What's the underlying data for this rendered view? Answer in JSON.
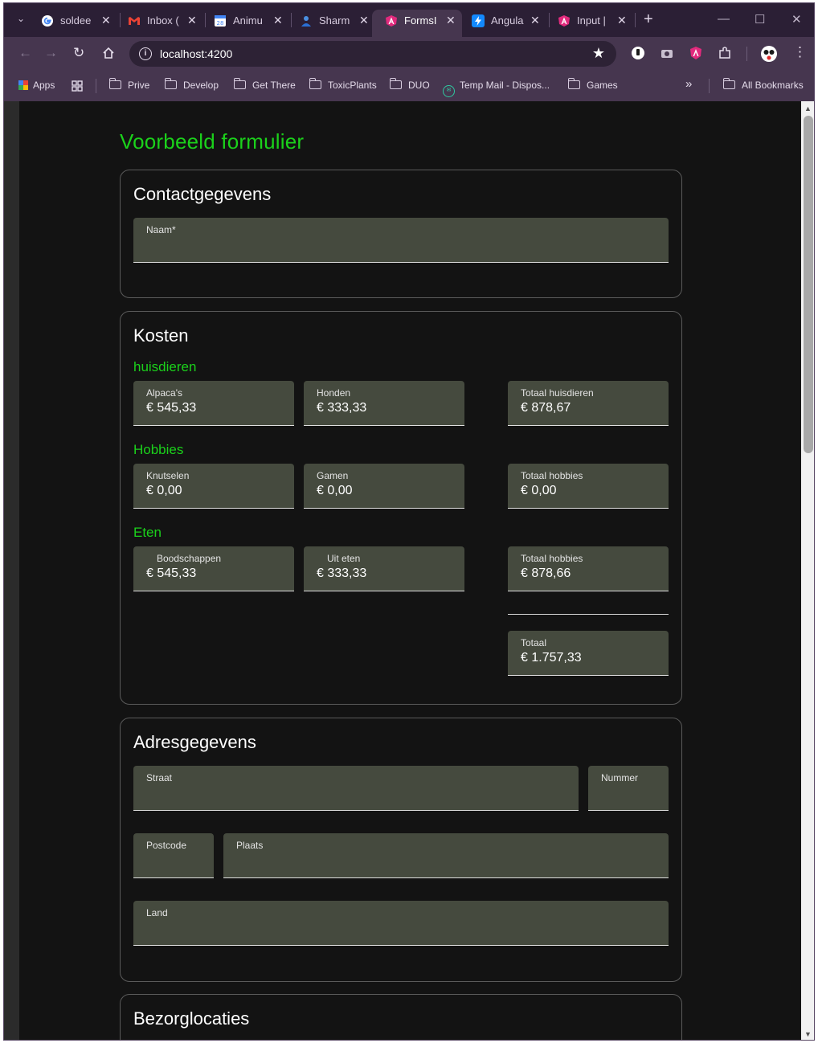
{
  "browser": {
    "tabs": [
      {
        "title": "soldee",
        "favicon": "google-icon"
      },
      {
        "title": "Inbox (",
        "favicon": "gmail-icon"
      },
      {
        "title": "Animu",
        "favicon": "calendar-icon"
      },
      {
        "title": "Sharm",
        "favicon": "person-icon"
      },
      {
        "title": "FormsI",
        "favicon": "angular-icon",
        "active": true
      },
      {
        "title": "Angula",
        "favicon": "stackblitz-icon"
      },
      {
        "title": "Input |",
        "favicon": "angular-icon"
      }
    ],
    "new_tab": "+",
    "address": "localhost:4200",
    "bookmarks": {
      "apps": "Apps",
      "items": [
        "Prive",
        "Develop",
        "Get There",
        "ToxicPlants",
        "DUO",
        "Temp Mail - Dispos...",
        "Games"
      ],
      "more": "»",
      "all": "All Bookmarks"
    }
  },
  "page": {
    "title": "Voorbeeld formulier",
    "contact": {
      "heading": "Contactgegevens",
      "name_label": "Naam*",
      "name_value": ""
    },
    "kosten": {
      "heading": "Kosten",
      "groups": [
        {
          "title": "huisdieren",
          "fields": [
            {
              "label": "Alpaca's",
              "value": "€ 545,33"
            },
            {
              "label": "Honden",
              "value": "€ 333,33"
            }
          ],
          "total": {
            "label": "Totaal huisdieren",
            "value": "€ 878,67"
          }
        },
        {
          "title": "Hobbies",
          "fields": [
            {
              "label": "Knutselen",
              "value": "€ 0,00"
            },
            {
              "label": "Gamen",
              "value": "€ 0,00"
            }
          ],
          "total": {
            "label": "Totaal hobbies",
            "value": "€ 0,00"
          }
        },
        {
          "title": "Eten",
          "fields": [
            {
              "label": "Boodschappen",
              "value": "€ 545,33"
            },
            {
              "label": "Uit eten",
              "value": "€ 333,33"
            }
          ],
          "total": {
            "label": "Totaal hobbies",
            "value": "€ 878,66"
          }
        }
      ],
      "grand_total": {
        "label": "Totaal",
        "value": "€ 1.757,33"
      }
    },
    "adres": {
      "heading": "Adresgegevens",
      "straat": "Straat",
      "nummer": "Nummer",
      "postcode": "Postcode",
      "plaats": "Plaats",
      "land": "Land"
    },
    "bezorg": {
      "heading": "Bezorglocaties"
    }
  }
}
